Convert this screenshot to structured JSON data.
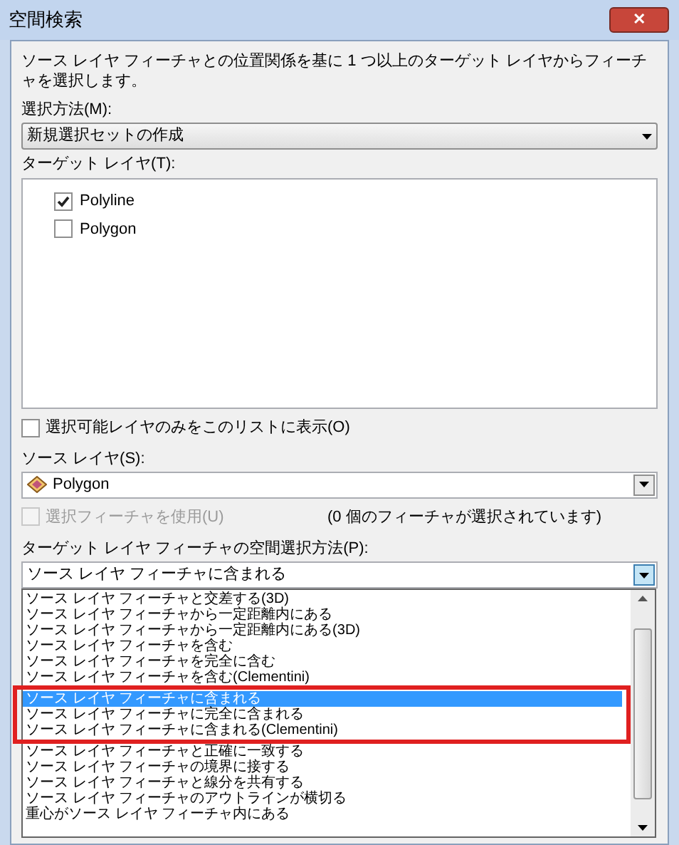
{
  "window": {
    "title": "空間検索",
    "close": "✕"
  },
  "description": "ソース レイヤ フィーチャとの位置関係を基に 1 つ以上のターゲット レイヤからフィーチャを選択します。",
  "selection_method": {
    "label": "選択方法(M):",
    "value": "新規選択セットの作成"
  },
  "target_layers": {
    "label": "ターゲット レイヤ(T):",
    "items": [
      {
        "name": "Polyline",
        "checked": true
      },
      {
        "name": "Polygon",
        "checked": false
      }
    ]
  },
  "selectable_only": {
    "label": "選択可能レイヤのみをこのリストに表示(O)",
    "checked": false
  },
  "source_layer": {
    "label": "ソース レイヤ(S):",
    "value": "Polygon"
  },
  "use_selected": {
    "label": "選択フィーチャを使用(U)",
    "checked": false,
    "disabled": true,
    "count": "(0 個のフィーチャが選択されています)"
  },
  "spatial_method": {
    "label": "ターゲット レイヤ フィーチャの空間選択方法(P):",
    "value": "ソース レイヤ フィーチャに含まれる",
    "options": [
      {
        "text": "ソース レイヤ フィーチャと交差する(3D)",
        "selected": false,
        "marked": false
      },
      {
        "text": "ソース レイヤ フィーチャから一定距離内にある",
        "selected": false,
        "marked": false
      },
      {
        "text": "ソース レイヤ フィーチャから一定距離内にある(3D)",
        "selected": false,
        "marked": false
      },
      {
        "text": "ソース レイヤ フィーチャを含む",
        "selected": false,
        "marked": false
      },
      {
        "text": "ソース レイヤ フィーチャを完全に含む",
        "selected": false,
        "marked": false
      },
      {
        "text": "ソース レイヤ フィーチャを含む(Clementini)",
        "selected": false,
        "marked": false
      },
      {
        "text": "ソース レイヤ フィーチャに含まれる",
        "selected": true,
        "marked": true
      },
      {
        "text": "ソース レイヤ フィーチャに完全に含まれる",
        "selected": false,
        "marked": true
      },
      {
        "text": "ソース レイヤ フィーチャに含まれる(Clementini)",
        "selected": false,
        "marked": true
      },
      {
        "text": "ソース レイヤ フィーチャと正確に一致する",
        "selected": false,
        "marked": false
      },
      {
        "text": "ソース レイヤ フィーチャの境界に接する",
        "selected": false,
        "marked": false
      },
      {
        "text": "ソース レイヤ フィーチャと線分を共有する",
        "selected": false,
        "marked": false
      },
      {
        "text": "ソース レイヤ フィーチャのアウトラインが横切る",
        "selected": false,
        "marked": false
      },
      {
        "text": "重心がソース レイヤ フィーチャ内にある",
        "selected": false,
        "marked": false
      }
    ]
  }
}
